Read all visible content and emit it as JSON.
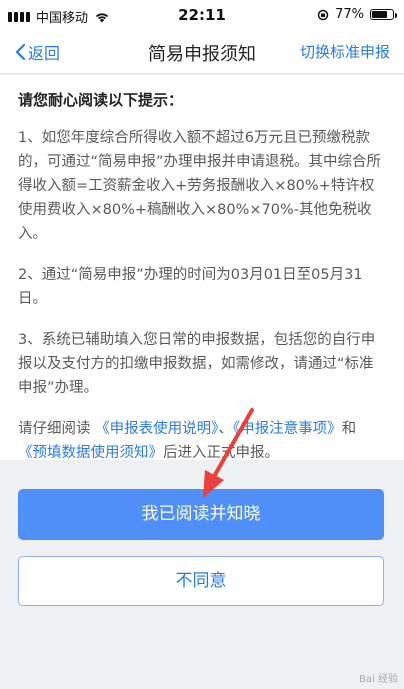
{
  "status": {
    "carrier": "中国移动",
    "time": "22:11",
    "battery": "77%",
    "battery_level": 0.77
  },
  "nav": {
    "back_label": "返回",
    "title": "简易申报须知",
    "right_label": "切换标准申报"
  },
  "notice": {
    "heading": "请您耐心阅读以下提示：",
    "item1": "1、如您年度综合所得收入额不超过6万元且已预缴税款的，可通过“简易申报”办理申报并申请退税。其中综合所得收入额=工资薪金收入+劳务报酬收入×80%+特许权使用费收入×80%+稿酬收入×80%×70%-其他免税收入。",
    "item2": "2、通过“简易申报”办理的时间为03月01日至05月31日。",
    "item3": "3、系统已辅助填入您日常的申报数据，包括您的自行申报以及支付方的扣缴申报数据，如需修改，请通过“标准申报”办理。",
    "footer_prefix": "请仔细阅读",
    "link1": "《申报表使用说明》",
    "sep1": "、",
    "link2": "《申报注意事项》",
    "mid": "和",
    "link3": "《预填数据使用须知》",
    "footer_suffix": "后进入正式申报。"
  },
  "buttons": {
    "agree": "我已阅读并知晓",
    "disagree": "不同意"
  },
  "colors": {
    "accent": "#2b7ae5",
    "primary_button": "#4f8ff7",
    "arrow": "#e8403a"
  }
}
